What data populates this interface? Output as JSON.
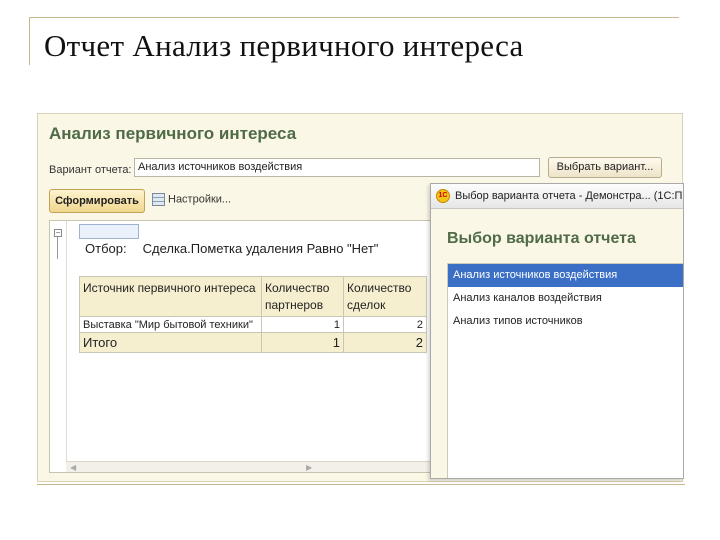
{
  "slide": {
    "title": "Отчет Анализ первичного интереса"
  },
  "report_form": {
    "title": "Анализ первичного интереса",
    "variant_label": "Вариант отчета:",
    "variant_value": "Анализ источников воздействия",
    "select_variant_button": "Выбрать вариант...",
    "generate_button": "Сформировать",
    "settings_button": "Настройки...",
    "filter_label": "Отбор:",
    "filter_value": "Сделка.Пометка удаления Равно \"Нет\"",
    "table": {
      "headers": [
        "Источник первичного интереса",
        "Количество партнеров",
        "Количество сделок"
      ],
      "rows": [
        [
          "Выставка \"Мир бытовой техники\"",
          "1",
          "2"
        ]
      ],
      "total": [
        "Итого",
        "1",
        "2"
      ]
    }
  },
  "dialog": {
    "title": "Выбор варианта отчета - Демонстра... (1С:Пр",
    "heading": "Выбор варианта отчета",
    "variants": [
      "Анализ источников воздействия",
      "Анализ каналов воздействия",
      "Анализ типов источников"
    ],
    "selected_index": 0
  },
  "colors": {
    "heading_green": "#4f6b48",
    "selection_blue": "#3a6fc5",
    "panel_bg": "#fbf7e6",
    "header_bg": "#f6efcf"
  },
  "icons": [
    "collapse-icon",
    "settings-icon",
    "1c-logo-icon",
    "scroll-left-icon",
    "scroll-right-icon"
  ]
}
